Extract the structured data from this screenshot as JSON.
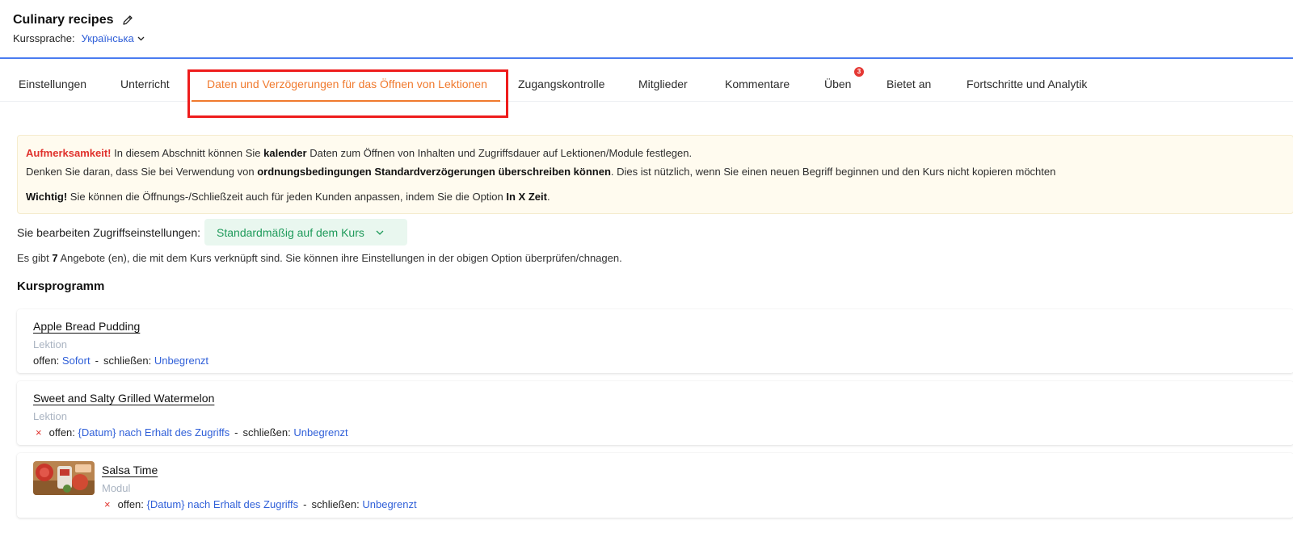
{
  "header": {
    "course_title": "Culinary recipes",
    "lang_label": "Kurssprache:",
    "lang_value": "Українська"
  },
  "tabs": [
    {
      "label": "Einstellungen"
    },
    {
      "label": "Unterricht"
    },
    {
      "label": "Daten und Verzögerungen für das Öffnen von Lektionen",
      "active": true
    },
    {
      "label": "Zugangskontrolle"
    },
    {
      "label": "Mitglieder"
    },
    {
      "label": "Kommentare"
    },
    {
      "label": "Üben",
      "badge": "3"
    },
    {
      "label": "Bietet an"
    },
    {
      "label": "Fortschritte und Analytik"
    }
  ],
  "notice": {
    "l1_warn": "Aufmerksamkeit!",
    "l1_a": " In diesem Abschnitt können Sie ",
    "l1_b": "kalender",
    "l1_c": " Daten zum Öffnen von Inhalten und Zugriffsdauer auf Lektionen/Module festlegen.",
    "l2_a": "Denken Sie daran, dass Sie bei Verwendung von ",
    "l2_b": "ordnungsbedingungen Standardverzögerungen überschreiben können",
    "l2_c": ". Dies ist nützlich, wenn Sie einen neuen Begriff beginnen und den Kurs nicht kopieren möchten",
    "l3_a": "Wichtig!",
    "l3_b": " Sie können die Öffnungs-/Schließzeit auch für jeden Kunden anpassen, indem Sie die Option ",
    "l3_c": "In X Zeit",
    "l3_d": "."
  },
  "access": {
    "label": "Sie bearbeiten Zugriffseinstellungen:",
    "value": "Standardmäßig auf dem Kurs"
  },
  "offers": {
    "a": "Es gibt ",
    "count": "7",
    "b": " Angebote (en), die mit dem Kurs verknüpft sind. Sie können ihre Einstellungen in der obigen Option überprüfen/chnagen."
  },
  "program": {
    "title": "Kursprogramm",
    "items": [
      {
        "title": "Apple Bread Pudding",
        "type": "Lektion",
        "open_label": "offen:",
        "open_value": "Sofort",
        "sep": "-",
        "close_label": "schließen:",
        "close_value": "Unbegrenzt"
      },
      {
        "title": "Sweet and Salty Grilled Watermelon",
        "type": "Lektion",
        "x": "×",
        "open_label": "offen:",
        "open_value": "{Datum} nach Erhalt des Zugriffs",
        "sep": "-",
        "close_label": "schließen:",
        "close_value": "Unbegrenzt"
      },
      {
        "title": "Salsa Time",
        "type": "Modul",
        "x": "×",
        "open_label": "offen:",
        "open_value": "{Datum} nach Erhalt des Zugriffs",
        "sep": "-",
        "close_label": "schließen:",
        "close_value": "Unbegrenzt"
      }
    ]
  },
  "colors": {
    "accent": "#f07a2e",
    "link": "#2f5fd8",
    "warning": "#e0312c",
    "header_border": "#4a7cf0",
    "select_bg": "#e9f7ef",
    "select_text": "#1e9a5a"
  },
  "icons": {
    "edit": "pencil-icon",
    "dropdown": "chevron-down-icon",
    "remove": "close-icon"
  }
}
